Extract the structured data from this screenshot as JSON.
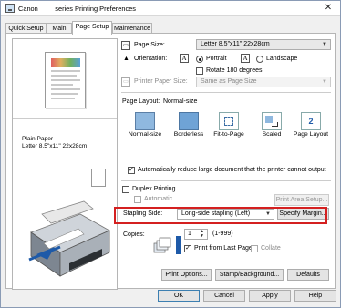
{
  "window": {
    "title": "Canon         series Printing Preferences",
    "close_glyph": "✕"
  },
  "tabs": [
    "Quick Setup",
    "Main",
    "Page Setup",
    "Maintenance"
  ],
  "active_tab": "Page Setup",
  "preview": {
    "media_line1": "Plain Paper",
    "media_line2": "Letter 8.5\"x11\" 22x28cm"
  },
  "page_size": {
    "label": "Page Size:",
    "value": "Letter 8.5\"x11\" 22x28cm"
  },
  "orientation": {
    "label": "Orientation:",
    "portrait": "Portrait",
    "landscape": "Landscape",
    "selected": "Portrait",
    "icon_letter": "A"
  },
  "rotate": {
    "label": "Rotate 180 degrees",
    "checked": false
  },
  "printer_paper_size": {
    "label": "Printer Paper Size:",
    "value": "Same as Page Size",
    "enabled": false
  },
  "page_layout": {
    "label": "Page Layout:",
    "current": "Normal-size",
    "options": [
      "Normal-size",
      "Borderless",
      "Fit-to-Page",
      "Scaled",
      "Page Layout"
    ],
    "page_layout_badge": "2"
  },
  "auto_reduce": {
    "label": "Automatically reduce large document that the printer cannot output",
    "checked": true
  },
  "duplex": {
    "label": "Duplex Printing",
    "checked": false
  },
  "automatic": {
    "label": "Automatic",
    "checked": false,
    "enabled": false
  },
  "print_area_button": "Print Area Setup...",
  "stapling": {
    "label": "Stapling Side:",
    "value": "Long-side stapling (Left)",
    "specify_button": "Specify Margin..."
  },
  "copies": {
    "label": "Copies:",
    "value": "1",
    "range": "(1-999)"
  },
  "print_from_last": {
    "label": "Print from Last Page",
    "checked": true
  },
  "collate": {
    "label": "Collate",
    "checked": false,
    "enabled": false
  },
  "buttons": {
    "print_options": "Print Options...",
    "stamp_background": "Stamp/Background...",
    "defaults": "Defaults"
  },
  "footer": {
    "ok": "OK",
    "cancel": "Cancel",
    "apply": "Apply",
    "help": "Help"
  },
  "colors": {
    "highlight_border": "#d42020",
    "accent_blue": "#1e5aa8"
  }
}
